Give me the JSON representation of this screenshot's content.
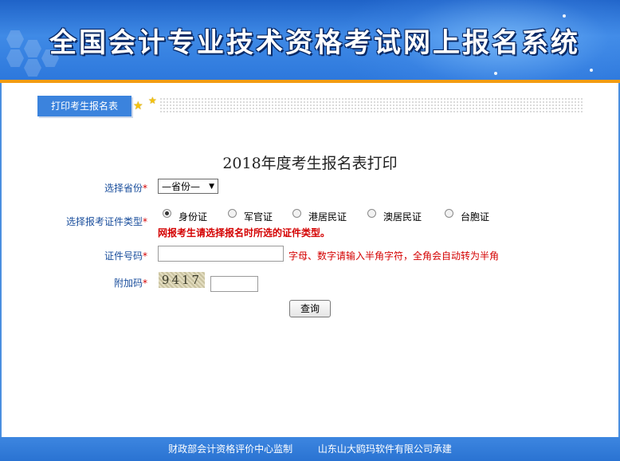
{
  "header": {
    "title": "全国会计专业技术资格考试网上报名系统"
  },
  "tab": {
    "label": "打印考生报名表"
  },
  "form": {
    "title": "2018年度考生报名表打印",
    "province": {
      "label": "选择省份",
      "required": "*",
      "selected": "—省份—"
    },
    "id_type": {
      "label": "选择报考证件类型",
      "required": "*",
      "options": [
        "身份证",
        "军官证",
        "港居民证",
        "澳居民证",
        "台胞证"
      ],
      "selected_index": 0,
      "hint": "网报考生请选择报名时所选的证件类型。"
    },
    "id_number": {
      "label": "证件号码",
      "required": "*",
      "value": "",
      "hint": "字母、数字请输入半角字符，全角会自动转为半角"
    },
    "captcha": {
      "label": "附加码",
      "required": "*",
      "image_text": "9417",
      "value": ""
    },
    "submit_label": "查询"
  },
  "footer": {
    "left": "财政部会计资格评价中心监制",
    "right": "山东山大鸥玛软件有限公司承建"
  },
  "colors": {
    "banner": "#2d78dc",
    "accent_orange": "#f39c12",
    "label_blue": "#1a4e9c",
    "required_red": "#d40000"
  }
}
